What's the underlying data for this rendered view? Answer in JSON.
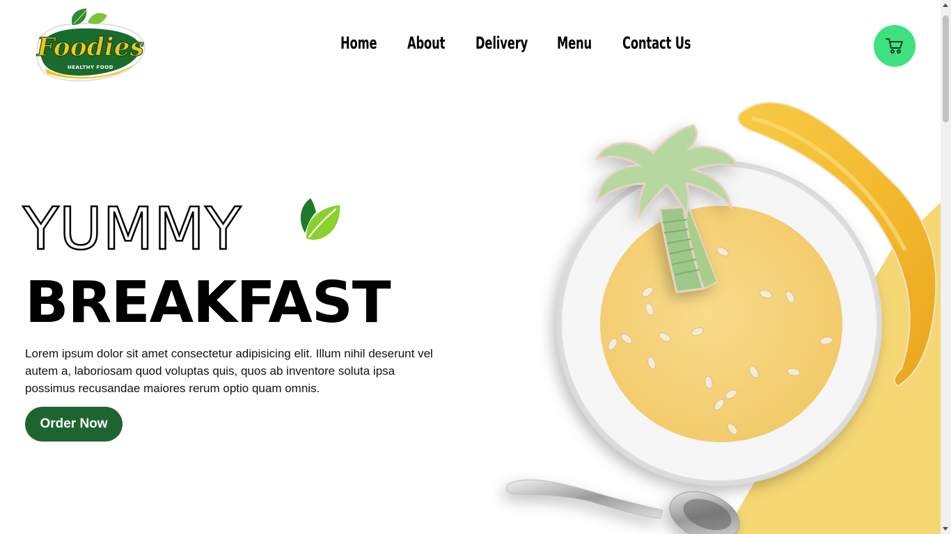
{
  "header": {
    "logo": {
      "brand": "Foodies",
      "tagline": "HEALTHY FOOD"
    },
    "nav": [
      {
        "label": "Home"
      },
      {
        "label": "About"
      },
      {
        "label": "Delivery"
      },
      {
        "label": "Menu"
      },
      {
        "label": "Contact Us"
      }
    ],
    "cart": {
      "icon": "cart-icon"
    }
  },
  "hero": {
    "title_outline": "YUMMY",
    "title_solid": "BREAKFAST",
    "description": "Lorem ipsum dolor sit amet consectetur adipisicing elit. Illum nihil deserunt vel autem a, laboriosam quod voluptas quis, quos ab inventore soluta ipsa possimus recusandae maiores rerum optio quam omnis.",
    "cta_label": "Order Now",
    "decor_icon": "leaf-icon",
    "image": "soup-bowl-with-palm-tree-banana-and-spoon"
  },
  "colors": {
    "cart_bg": "#3ee07f",
    "cta_bg": "#1e6430",
    "accent_yellow": "#f5d774",
    "leaf_dark": "#1f7a2d",
    "leaf_light": "#8bd12d"
  }
}
